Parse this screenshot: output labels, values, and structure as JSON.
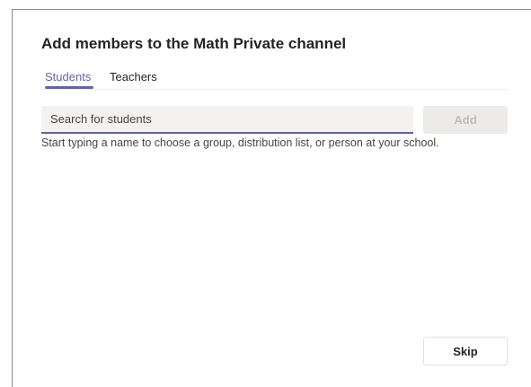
{
  "dialog": {
    "title": "Add members to the Math Private channel",
    "tabs": [
      {
        "label": "Students",
        "active": true
      },
      {
        "label": "Teachers",
        "active": false
      }
    ],
    "search": {
      "placeholder": "Search for students",
      "value": ""
    },
    "add_label": "Add",
    "hint": "Start typing a name to choose a group, distribution list, or person at your school.",
    "skip_label": "Skip"
  },
  "colors": {
    "accent": "#6264a7",
    "disabled_button_bg": "#edebe9",
    "disabled_button_text": "#bdbdbd",
    "input_bg": "#f3f2f1"
  }
}
